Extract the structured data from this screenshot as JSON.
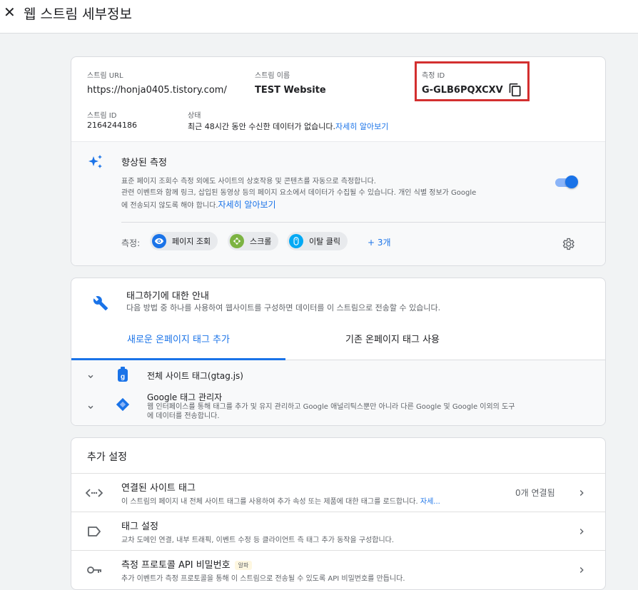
{
  "header": {
    "title": "웹 스트림 세부정보"
  },
  "stream": {
    "url_label": "스트림 URL",
    "url_value": "https://honja0405.tistory.com/",
    "name_label": "스트림 이름",
    "name_value": "TEST Website",
    "measurement_id_label": "측정 ID",
    "measurement_id_value": "G-GLB6PQXCXV",
    "stream_id_label": "스트림 ID",
    "stream_id_value": "2164244186",
    "status_label": "상태",
    "status_text": "최근 48시간 동안 수신한 데이터가 없습니다.",
    "status_link": "자세히 알아보기"
  },
  "enhanced": {
    "title": "향상된 측정",
    "desc_line1": "표준 페이지 조회수 측정 외에도 사이트의 상호작용 및 콘텐츠를 자동으로 측정합니다.",
    "desc_line2": "관련 이벤트와 함께 링크, 삽입된 동영상 등의 페이지 요소에서 데이터가 수집될 수 있습니다. 개인 식별 정보가 Google",
    "desc_line3": "에 전송되지 않도록 해야 합니다.",
    "desc_link": "자세히 알아보기",
    "toggle_on": true,
    "measure_label": "측정:",
    "chips": [
      "페이지 조회",
      "스크롤",
      "이탈 클릭"
    ],
    "more": "+ 3개"
  },
  "tagging": {
    "title": "태그하기에 대한 안내",
    "desc": "다음 방법 중 하나를 사용하여 웹사이트를 구성하면 데이터를 이 스트림으로 전송할 수 있습니다.",
    "tabs": [
      "새로운 온페이지 태그 추가",
      "기존 온페이지 태그 사용"
    ],
    "items": [
      {
        "title": "전체 사이트 태그(gtag.js)"
      },
      {
        "title": "Google 태그 관리자",
        "desc1": "웹 인터페이스를 통해 태그를 추가 및 유지 관리하고 Google 애널리틱스뿐만 아니라 다른 Google 및 Google 이외의 도구",
        "desc2": "에 데이터를 전송합니다."
      }
    ]
  },
  "additional": {
    "title": "추가 설정",
    "rows": [
      {
        "title": "연결된 사이트 태그",
        "desc": "이 스트림의 페이지 내 전체 사이트 태그를 사용하여 추가 속성 또는 제품에 대한 태그를 로드합니다.",
        "desc_link": "자세...",
        "status": "0개 연결됨"
      },
      {
        "title": "태그 설정",
        "desc": "교차 도메인 연결, 내부 트래픽, 이벤트 수정 등 클라이언트 측 태그 추가 동작을 구성합니다."
      },
      {
        "title": "측정 프로토콜 API 비밀번호",
        "badge": "알파",
        "desc": "추가 이벤트가 측정 프로토콜을 통해 이 스트림으로 전송될 수 있도록 API 비밀번호를 만듭니다."
      }
    ]
  },
  "colors": {
    "accent": "#1a73e8",
    "highlight": "#d32f2f",
    "chip_page": "#1a73e8",
    "chip_scroll": "#7cb342",
    "chip_click": "#03a9f4"
  },
  "icons": [
    "close-icon",
    "copy-icon",
    "sparkle-icon",
    "gear-icon",
    "wrench-icon",
    "gtag-icon",
    "tag-manager-icon",
    "code-icon",
    "label-icon",
    "key-icon",
    "chevron-down-icon",
    "chevron-right-icon"
  ]
}
